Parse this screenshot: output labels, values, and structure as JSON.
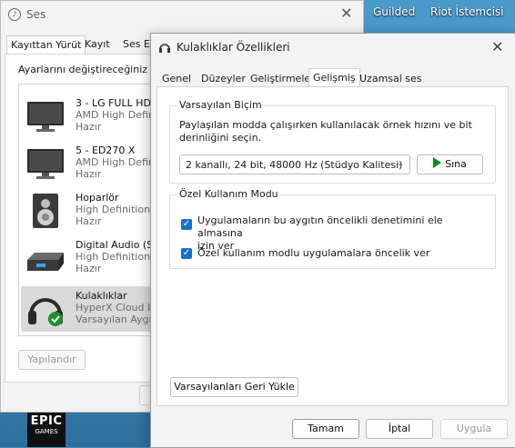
{
  "desktop": {
    "icons": [
      "Guilded",
      "Riot İstemcisi"
    ],
    "epic": {
      "line1": "EPIC",
      "line2": "GAMES"
    }
  },
  "ses": {
    "title": "Ses",
    "tabs": [
      "Kayıttan Yürüt",
      "Kayıt",
      "Ses Ef"
    ],
    "instruction": "Ayarlarını değiştireceğiniz ka",
    "devices": [
      {
        "name": "3 - LG FULL HD",
        "driver": "AMD High Defini",
        "status": "Hazır",
        "icon": "monitor-icon"
      },
      {
        "name": "5 - ED270 X",
        "driver": "AMD High Defini",
        "status": "Hazır",
        "icon": "monitor-icon"
      },
      {
        "name": "Hoparlör",
        "driver": "High Definition",
        "status": "Hazır",
        "icon": "speaker-icon"
      },
      {
        "name": "Digital Audio (S",
        "driver": "High Definition",
        "status": "Hazır",
        "icon": "digital-audio-icon"
      },
      {
        "name": "Kulaklıklar",
        "driver": "HyperX Cloud II",
        "status": "Varsayılan Aygıt",
        "icon": "headphones-icon"
      }
    ],
    "configure_label": "Yapılandır"
  },
  "props": {
    "title": "Kulaklıklar Özellikleri",
    "tabs": [
      "Genel",
      "Düzeyler",
      "Geliştirmeler",
      "Gelişmiş",
      "Uzamsal ses"
    ],
    "active_tab": "Gelişmiş",
    "default_format": {
      "label": "Varsayılan Biçim",
      "description_line1": "Paylaşılan modda çalışırken kullanılacak örnek hızını ve bit",
      "description_line2": "derinliğini seçin.",
      "selected": "2 kanallı, 24 bit, 48000 Hz (Stüdyo Kalitesi)",
      "test_label": "Sına"
    },
    "exclusive_mode": {
      "label": "Özel Kullanım Modu",
      "option1_line1": "Uygulamaların bu aygıtın öncelikli denetimini ele almasına",
      "option1_line2": "izin ver",
      "option1_checked": true,
      "option2": "Özel kullanım modlu uygulamalara öncelik ver",
      "option2_checked": true
    },
    "restore_defaults": "Varsayılanları Geri Yükle",
    "ok": "Tamam",
    "cancel": "İptal",
    "apply": "Uygula"
  },
  "colors": {
    "accent": "#1a6fc9",
    "play": "#0a8a1a",
    "selected_row": "#d9d9d9"
  }
}
